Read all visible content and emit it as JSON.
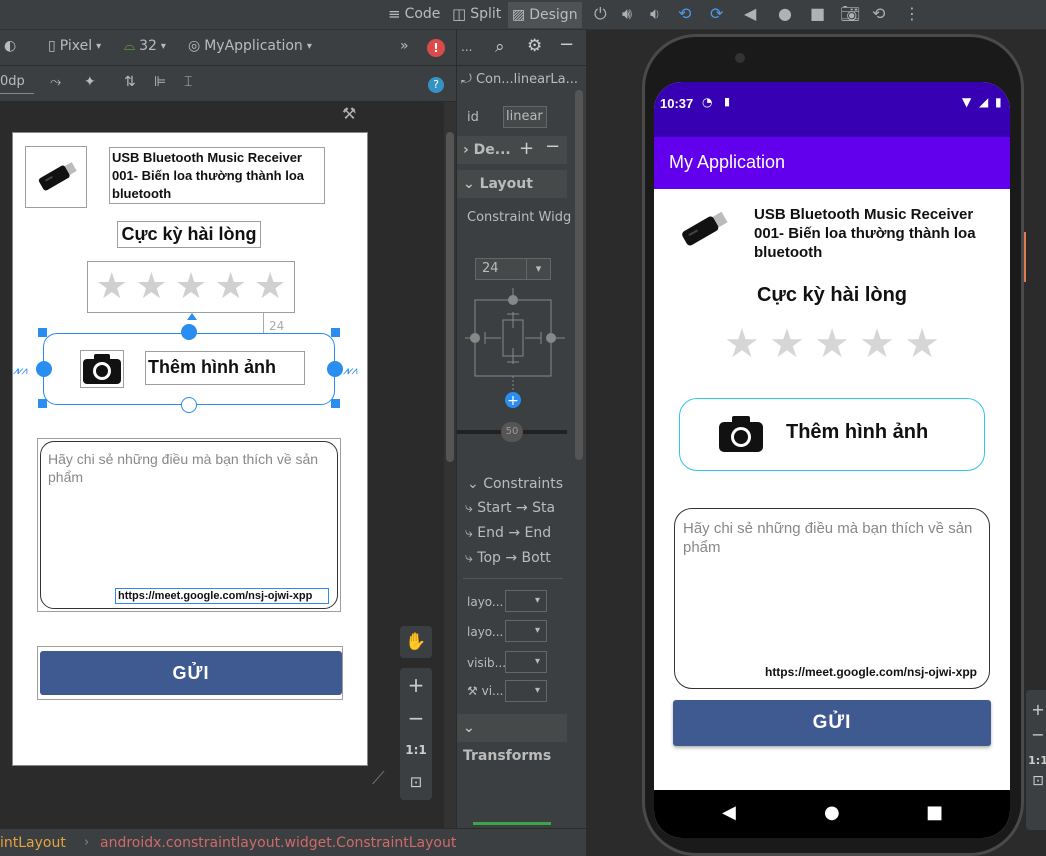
{
  "ide": {
    "view_modes": {
      "code": "Code",
      "split": "Split",
      "design": "Design"
    },
    "device": "Pixel",
    "api_level": "32",
    "theme": "MyApplication",
    "margin_value": "0dp",
    "attributes_title": "Con...linearLa...",
    "id_label": "id",
    "id_value": "linear",
    "declared_label": "De...",
    "layout_section": "Layout",
    "constraint_widget": "Constraint Widg",
    "margin_top": "24",
    "bias": "50",
    "constraints_header": "Constraints",
    "constraints": [
      "Start → Sta",
      "End → End",
      "Top → Bott"
    ],
    "attr_rows": [
      "layo...",
      "layo...",
      "visib...",
      "vi..."
    ],
    "transforms": "Transforms",
    "breadcrumb_1": "intLayout",
    "breadcrumb_2": "androidx.constraintlayout.widget.ConstraintLayout",
    "zoom_label": "1:1",
    "canvas_margin_badge": "24"
  },
  "content": {
    "product_title": "USB Bluetooth Music Receiver 001- Biến loa thường thành loa bluetooth",
    "rating_text": "Cực kỳ hài lòng",
    "add_photo_label": "Thêm hình ảnh",
    "review_placeholder": "Hãy chi sẻ những điều mà bạn thích về sản phẩm",
    "review_link": "https://meet.google.com/nsj-ojwi-xpp",
    "submit_label": "GỬI",
    "stars": 5
  },
  "phone": {
    "time": "10:37",
    "app_title": "My Application"
  },
  "colors": {
    "primary": "#6200ee",
    "primary_dark": "#3700b3",
    "button": "#3f5a91",
    "accent_border": "#2ec5e8",
    "ide_bg": "#3c3f41",
    "ide_selection": "#2a8df0"
  }
}
